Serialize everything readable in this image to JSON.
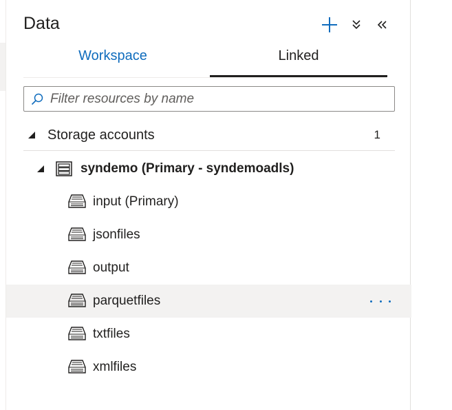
{
  "panel": {
    "title": "Data",
    "buttons": {
      "add": "plus-icon",
      "expand": "chevron-double-down-icon",
      "collapse": "chevron-double-left-icon"
    }
  },
  "tabs": [
    {
      "label": "Workspace",
      "selected": false
    },
    {
      "label": "Linked",
      "selected": true
    }
  ],
  "search": {
    "placeholder": "Filter resources by name",
    "value": ""
  },
  "tree": {
    "group": {
      "label": "Storage accounts",
      "count": "1",
      "expanded": true
    },
    "account": {
      "label": "syndemo (Primary - syndemoadls)",
      "expanded": true
    },
    "containers": [
      {
        "label": "input (Primary)"
      },
      {
        "label": "jsonfiles"
      },
      {
        "label": "output"
      },
      {
        "label": "parquetfiles",
        "hovered": true,
        "more_label": "more-actions-icon"
      },
      {
        "label": "txtfiles"
      },
      {
        "label": "xmlfiles"
      }
    ]
  },
  "colors": {
    "accent": "#0f6cbd",
    "hover_row": "#f3f2f1",
    "text": "#201f1e"
  }
}
